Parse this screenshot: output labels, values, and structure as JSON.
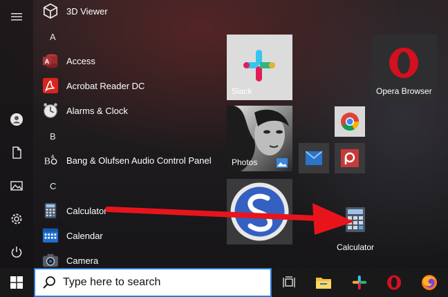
{
  "apps": [
    {
      "label": "3D Viewer",
      "icon": "3d-viewer-icon"
    },
    {
      "label": "Access",
      "icon": "access-icon"
    },
    {
      "label": "Acrobat Reader DC",
      "icon": "acrobat-icon"
    },
    {
      "label": "Alarms & Clock",
      "icon": "alarm-clock-icon"
    },
    {
      "label": "Bang & Olufsen Audio Control Panel",
      "icon": "bang-olufsen-icon"
    },
    {
      "label": "Calculator",
      "icon": "calculator-icon"
    },
    {
      "label": "Calendar",
      "icon": "calendar-icon"
    },
    {
      "label": "Camera",
      "icon": "camera-icon"
    }
  ],
  "letters": [
    "A",
    "B",
    "C"
  ],
  "tiles": {
    "slack": "Slack",
    "opera": "Opera Browser",
    "photos": "Photos",
    "calculator": "Calculator"
  },
  "search": {
    "placeholder": "Type here to search"
  },
  "rail": [
    "hamburger-menu-icon",
    "user-account-icon",
    "documents-icon",
    "pictures-icon",
    "settings-icon",
    "power-icon"
  ],
  "taskbar": [
    "task-view-icon",
    "file-explorer-icon",
    "slack-icon",
    "opera-icon",
    "firefox-icon"
  ],
  "colors": {
    "accent": "#2b7bd3",
    "arrow": "#e8141c",
    "taskbar": "#191919"
  }
}
